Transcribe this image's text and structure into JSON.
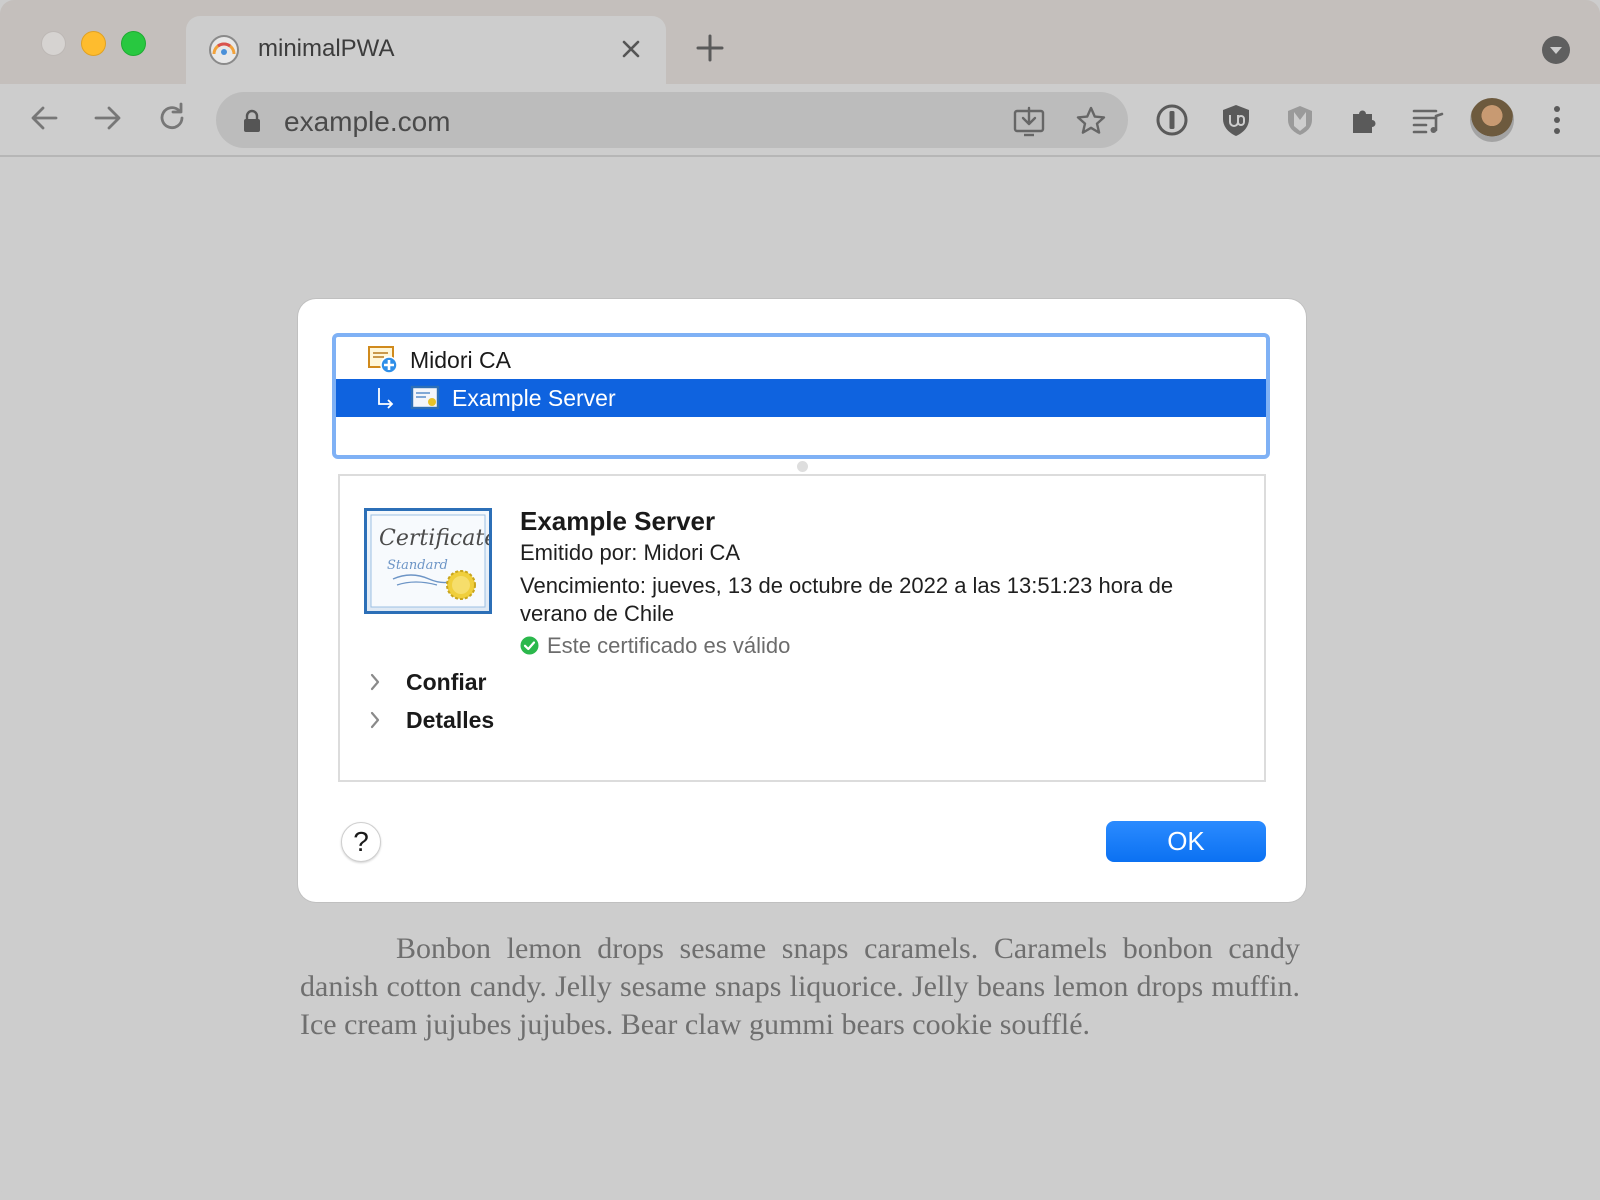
{
  "browser": {
    "tab_title": "minimalPWA",
    "url": "example.com",
    "colors": {
      "tabstrip": "#c4bfbc",
      "toolbar": "#cdcdcd",
      "omnibox": "#bcbcbc"
    }
  },
  "dialog": {
    "cert_list": [
      {
        "label": "Midori CA",
        "icon": "certificate-authority-icon",
        "selected": false
      },
      {
        "label": "Example Server",
        "icon": "certificate-icon",
        "selected": true
      }
    ],
    "detail": {
      "name": "Example Server",
      "issuer": "Emitido por: Midori CA",
      "expiry": "Vencimiento: jueves, 13 de octubre de 2022 a las 13:51:23 hora de verano de Chile",
      "validity": "Este certificado es válido",
      "trust_label": "Confiar",
      "details_label": "Detalles"
    },
    "help_label": "?",
    "ok_label": "OK",
    "colors": {
      "selection": "#0f63df",
      "focus_ring": "#7fb1f5",
      "ok_button": "#0b71f2",
      "valid": "#2bb84c"
    }
  },
  "page": {
    "paragraph": "Bonbon lemon drops sesame snaps caramels. Caramels bonbon candy danish cotton candy. Jelly sesame snaps liquorice. Jelly beans lemon drops muffin. Ice cream jujubes jujubes. Bear claw gummi bears cookie soufflé."
  }
}
